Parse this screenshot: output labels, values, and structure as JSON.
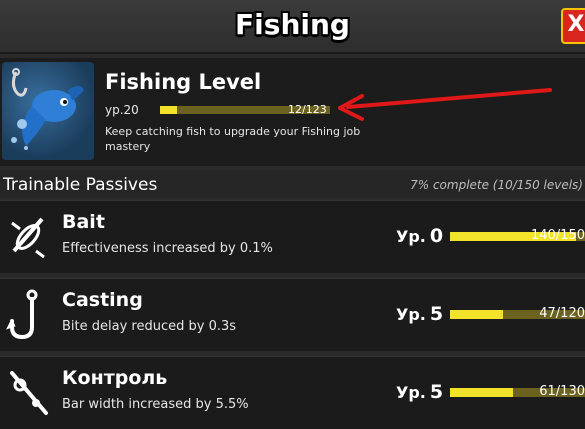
{
  "header": {
    "title": "Fishing",
    "close_label": "X"
  },
  "level_panel": {
    "title": "Fishing Level",
    "level_label": "ур.20",
    "progress_text": "12/123",
    "progress_fraction": 0.098,
    "description": "Keep catching fish to upgrade your Fishing job mastery"
  },
  "passives": {
    "title": "Trainable Passives",
    "completion": "7% complete (10/150 levels)"
  },
  "rows": [
    {
      "name": "Bait",
      "desc": "Effectiveness increased by 0.1%",
      "level_prefix": "Ур.",
      "level": "0",
      "count": "140/150",
      "fraction": 0.93,
      "icon": "bait-icon"
    },
    {
      "name": "Casting",
      "desc": "Bite delay reduced by 0.3s",
      "level_prefix": "Ур.",
      "level": "5",
      "count": "47/120",
      "fraction": 0.39,
      "icon": "hook-icon"
    },
    {
      "name": "Контроль",
      "desc": "Bar width increased by 5.5%",
      "level_prefix": "Ур.",
      "level": "5",
      "count": "61/130",
      "fraction": 0.47,
      "icon": "rod-icon"
    }
  ],
  "colors": {
    "bar_fill": "#f3e22a",
    "bar_bg": "#6b6220",
    "arrow": "#e01818",
    "close": "#d8261f"
  }
}
